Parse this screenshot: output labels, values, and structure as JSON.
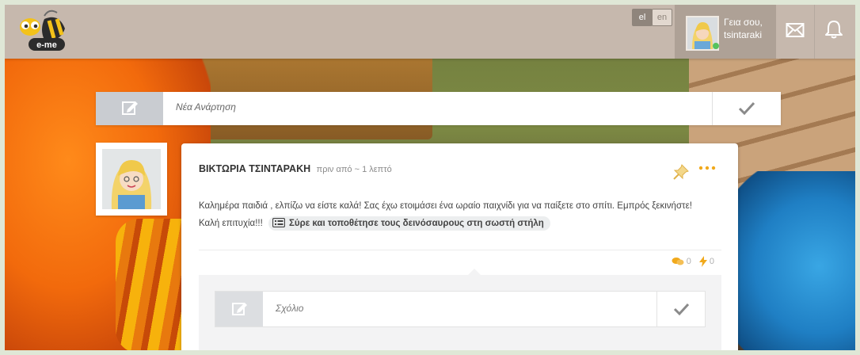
{
  "header": {
    "logo_text": "e-me",
    "languages": [
      {
        "code": "el",
        "active": true
      },
      {
        "code": "en",
        "active": false
      }
    ],
    "greeting_line1": "Γεια σου,",
    "greeting_line2": "tsintaraki",
    "icons": [
      "mail-icon",
      "bell-icon"
    ]
  },
  "new_post": {
    "placeholder": "Νέα Ανάρτηση",
    "icon": "edit-icon",
    "submit_icon": "check-icon"
  },
  "post": {
    "author": "ΒΙΚΤΩΡΙΑ ΤΣΙΝΤΑΡΑΚΗ",
    "time": "πριν από ~ 1 λεπτό",
    "body_line1": "Καλημέρα παιδιά , ελπίζω να είστε καλά! Σας έχω ετοιμάσει ένα ωραίο παιχνίδι για να παίξετε στο σπίτι. Εμπρός ξεκινήστε!",
    "body_line2": "Καλή επιτυχία!!!",
    "attachment_label": "Σύρε και τοποθέτησε τους δεινόσαυρους στη σωστή στήλη",
    "comments_count": "0",
    "likes_count": "0",
    "comment_placeholder": "Σχόλιο"
  },
  "colors": {
    "header_bg": "#c6b8ad",
    "accent": "#f1a91b",
    "icon_bar": "#c9ccd1"
  }
}
